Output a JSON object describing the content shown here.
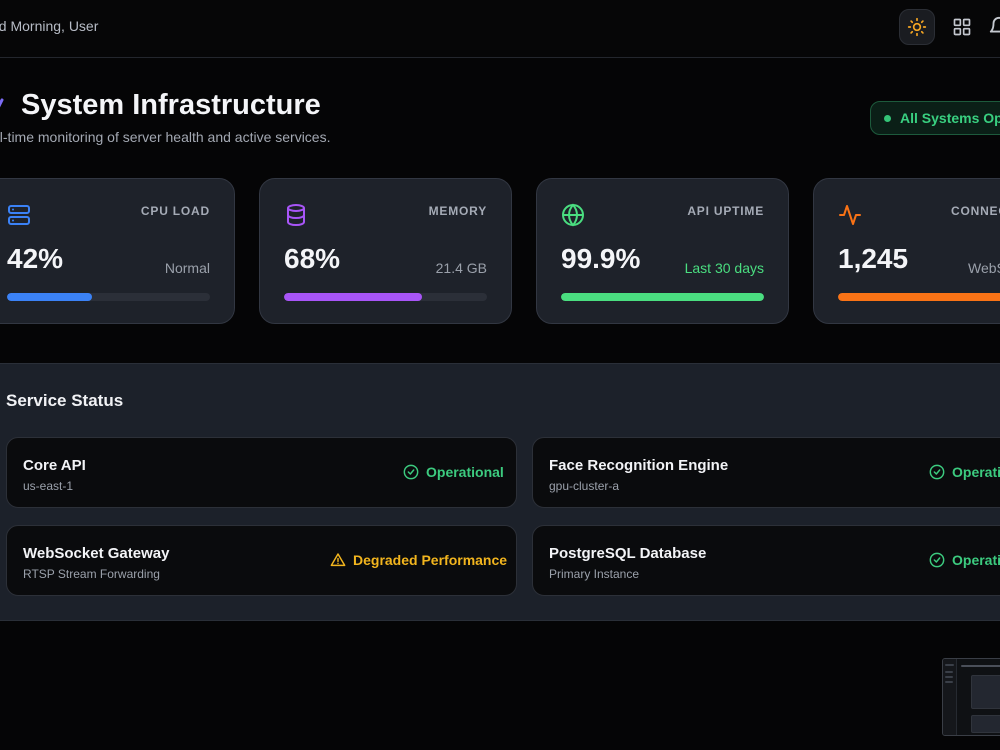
{
  "header": {
    "greeting": "od Morning, User",
    "icons": [
      "sun-icon",
      "grid-icon",
      "bell-icon"
    ]
  },
  "page": {
    "title": "System Infrastructure",
    "subtitle": "al-time monitoring of server health and active services.",
    "system_status": "All Systems Ope"
  },
  "metrics": [
    {
      "label": "CPU LOAD",
      "value": "42%",
      "sub": "Normal",
      "progress": 0.42,
      "color": "#3b82f6",
      "icon": "server-icon"
    },
    {
      "label": "MEMORY",
      "value": "68%",
      "sub": "21.4 GB",
      "progress": 0.68,
      "color": "#a855f7",
      "icon": "database-icon"
    },
    {
      "label": "API UPTIME",
      "value": "99.9%",
      "sub": "Last 30 days",
      "progress": 0.999,
      "color": "#4ade80",
      "icon": "globe-icon"
    },
    {
      "label": "CONNEC",
      "value": "1,245",
      "sub": "WebS",
      "progress": 0.95,
      "color": "#f97316",
      "icon": "activity-icon"
    }
  ],
  "services": {
    "title": "Service Status",
    "items": [
      {
        "name": "Core API",
        "meta": "us-east-1",
        "status": "Operational",
        "state": "ok"
      },
      {
        "name": "Face Recognition Engine",
        "meta": "gpu-cluster-a",
        "status": "Operatio",
        "state": "ok"
      },
      {
        "name": "WebSocket Gateway",
        "meta": "RTSP Stream Forwarding",
        "status": "Degraded Performance",
        "state": "warn"
      },
      {
        "name": "PostgreSQL Database",
        "meta": "Primary Instance",
        "status": "Operatio",
        "state": "ok"
      }
    ]
  },
  "colors": {
    "ok": "#3ccb7f",
    "warn": "#f2b51e",
    "accent_sun": "#f5a623"
  }
}
